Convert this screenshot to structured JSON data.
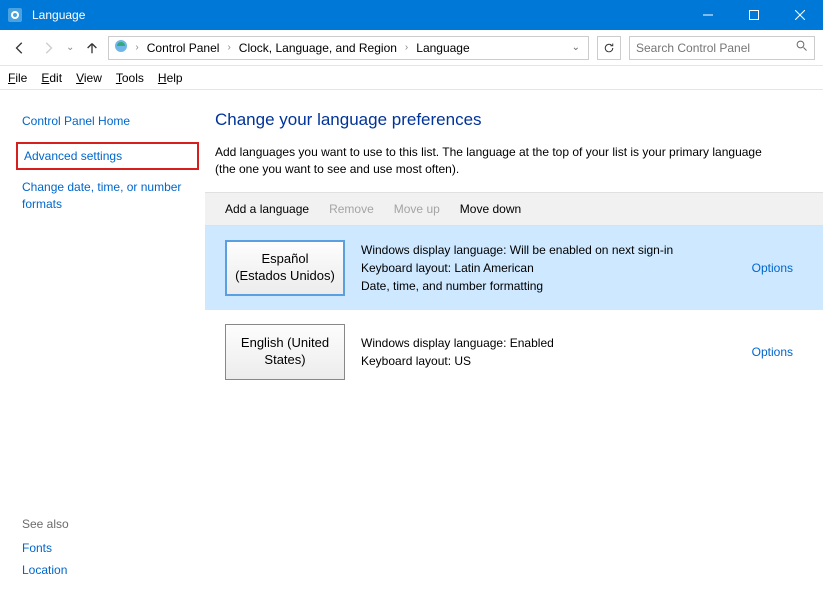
{
  "window": {
    "title": "Language"
  },
  "breadcrumb": {
    "root": "Control Panel",
    "mid": "Clock, Language, and Region",
    "leaf": "Language"
  },
  "search": {
    "placeholder": "Search Control Panel"
  },
  "menu": {
    "file": "File",
    "edit": "Edit",
    "view": "View",
    "tools": "Tools",
    "help": "Help"
  },
  "sidebar": {
    "home": "Control Panel Home",
    "advanced": "Advanced settings",
    "datefmt": "Change date, time, or number formats",
    "seealso": "See also",
    "fonts": "Fonts",
    "location": "Location"
  },
  "content": {
    "heading": "Change your language preferences",
    "desc": "Add languages you want to use to this list. The language at the top of your list is your primary language (the one you want to see and use most often)."
  },
  "toolbar": {
    "add": "Add a language",
    "remove": "Remove",
    "moveup": "Move up",
    "movedown": "Move down"
  },
  "languages": [
    {
      "name": "Español (Estados Unidos)",
      "line1": "Windows display language: Will be enabled on next sign-in",
      "line2": "Keyboard layout: Latin American",
      "line3": "Date, time, and number formatting",
      "options": "Options",
      "selected": true
    },
    {
      "name": "English (United States)",
      "line1": "Windows display language: Enabled",
      "line2": "Keyboard layout: US",
      "line3": "",
      "options": "Options",
      "selected": false
    }
  ]
}
